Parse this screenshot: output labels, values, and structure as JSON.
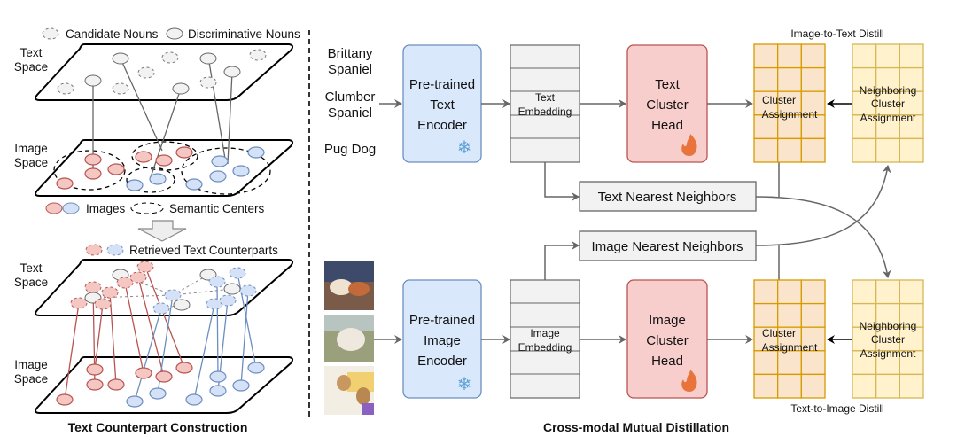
{
  "left_panel": {
    "legend_top": {
      "candidate": "Candidate Nouns",
      "discriminative": "Discriminative Nouns"
    },
    "text_space_label_1": "Text",
    "text_space_label_2": "Space",
    "image_space_label_1": "Image",
    "image_space_label_2": "Space",
    "legend_mid": {
      "images": "Images",
      "semantic_centers": "Semantic Centers"
    },
    "legend_retrieved": "Retrieved Text Counterparts",
    "title": "Text Counterpart Construction"
  },
  "right_panel": {
    "inputs_text": [
      "Brittany",
      "Spaniel",
      "Clumber",
      "Spaniel",
      "Pug Dog"
    ],
    "text_encoder": [
      "Pre-trained",
      "Text",
      "Encoder"
    ],
    "image_encoder": [
      "Pre-trained",
      "Image",
      "Encoder"
    ],
    "text_embedding": [
      "Text",
      "Embedding"
    ],
    "image_embedding": [
      "Image",
      "Embedding"
    ],
    "text_cluster_head": [
      "Text",
      "Cluster",
      "Head"
    ],
    "image_cluster_head": [
      "Image",
      "Cluster",
      "Head"
    ],
    "cluster_assignment": [
      "Cluster",
      "Assignment"
    ],
    "neighboring_assignment": [
      "Neighboring",
      "Cluster",
      "Assignment"
    ],
    "text_nn": "Text Nearest Neighbors",
    "image_nn": "Image Nearest Neighbors",
    "i2t": "Image-to-Text Distill",
    "t2i": "Text-to-Image Distill",
    "title": "Cross-modal Mutual Distillation",
    "icons": {
      "frozen": "snowflake-icon",
      "trainable": "fire-icon"
    }
  },
  "colors": {
    "encoder_fill": "#dae8fc",
    "encoder_stroke": "#6c8ebf",
    "head_fill": "#f8cecc",
    "head_stroke": "#b85450",
    "assign_fill": "#fae5cc",
    "assign_stroke": "#d79b00",
    "neighbor_fill": "#fff2cc",
    "neighbor_stroke": "#d6b656",
    "red_node": "#f4c7c3",
    "blue_node": "#d4e1f7"
  }
}
